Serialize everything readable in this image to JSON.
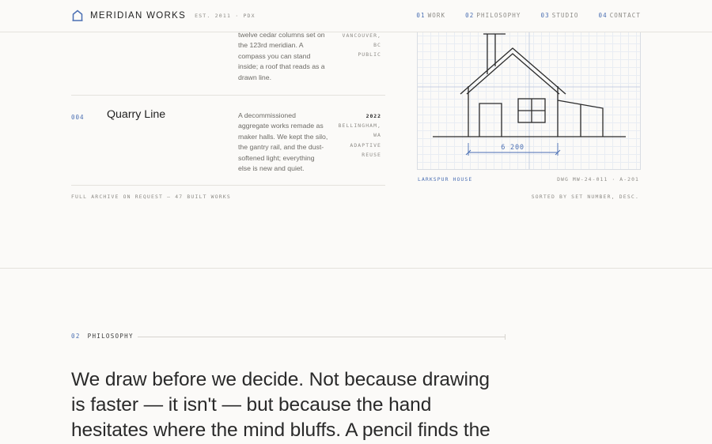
{
  "header": {
    "brand_name": "MERIDIAN WORKS",
    "brand_est": "EST. 2011 · PDX",
    "nav": [
      {
        "num": "01",
        "label": "WORK"
      },
      {
        "num": "02",
        "label": "PHILOSOPHY"
      },
      {
        "num": "03",
        "label": "STUDIO"
      },
      {
        "num": "04",
        "label": "CONTACT"
      }
    ]
  },
  "work": {
    "prev_row": {
      "desc": [
        "twelve cedar columns set on",
        "the 123rd meridian. A",
        "compass you can stand",
        "inside; a roof that reads as a",
        "drawn line."
      ],
      "meta": [
        "VANCOUVER,",
        "BC",
        "PUBLIC"
      ]
    },
    "row": {
      "num": "004",
      "title": "Quarry Line",
      "desc": [
        "A decommissioned",
        "aggregate works remade as",
        "maker halls. We kept the silo,",
        "the gantry rail, and the dust-",
        "softened light; everything",
        "else is new and quiet."
      ],
      "year": "2022",
      "meta": [
        "BELLINGHAM,",
        "WA",
        "ADAPTIVE",
        "REUSE"
      ]
    },
    "archive_note": "FULL ARCHIVE ON REQUEST — 47 BUILT WORKS"
  },
  "drawing": {
    "dimension": "6 200",
    "caption_left": "LARKSPUR HOUSE",
    "caption_right": "DWG MW-24-011 · A-201",
    "sorted_note": "SORTED BY SET NUMBER, DESC.",
    "colors": {
      "accent": "#4b6fb3",
      "line": "#2b2b2b",
      "grid": "#e9edf3"
    }
  },
  "philosophy": {
    "num": "02",
    "label": "PHILOSOPHY",
    "quote": [
      "We draw before we decide. Not because drawing",
      "is faster — it isn't — but because the hand",
      "hesitates where the mind bluffs. A pencil finds the"
    ]
  }
}
